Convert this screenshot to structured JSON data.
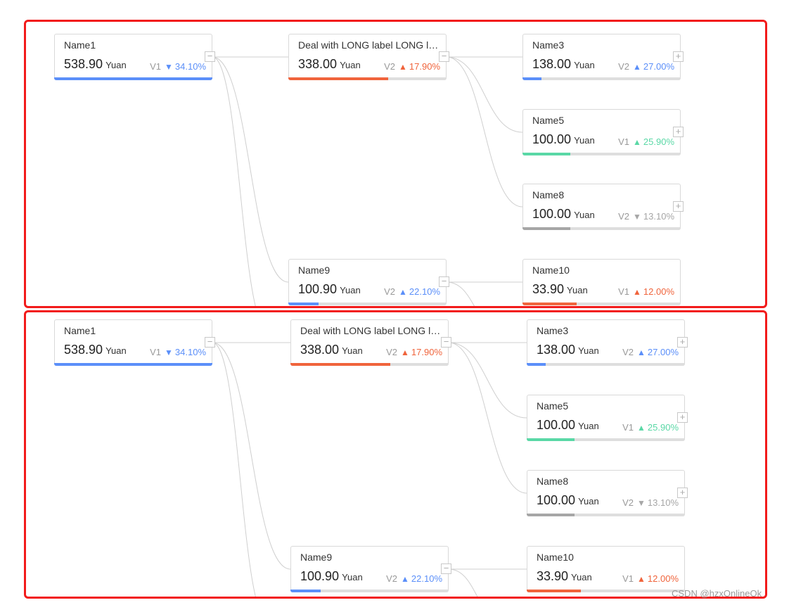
{
  "colors": {
    "blue": "#5b8ff9",
    "red": "#f0643c",
    "green": "#5ad8a6",
    "gray": "#a6a6a6",
    "frame": "#f21b1b"
  },
  "watermark": "CSDN @hzxOnlineOk",
  "panels": [
    {
      "id": "top",
      "nodes": [
        {
          "id": "n1",
          "name": "Name1",
          "value": "538.90",
          "unit": "Yuan",
          "tag": "V1",
          "dir": "down",
          "pct": "34.10%",
          "color": "blue",
          "progress": 1.0,
          "toggle": "−"
        },
        {
          "id": "n2",
          "name": "Deal with LONG label LONG la...",
          "value": "338.00",
          "unit": "Yuan",
          "tag": "V2",
          "dir": "up",
          "pct": "17.90%",
          "color": "red",
          "progress": 0.63,
          "toggle": "−"
        },
        {
          "id": "n3",
          "name": "Name3",
          "value": "138.00",
          "unit": "Yuan",
          "tag": "V2",
          "dir": "up",
          "pct": "27.00%",
          "color": "blue",
          "progress": 0.12,
          "toggle": "+"
        },
        {
          "id": "n5",
          "name": "Name5",
          "value": "100.00",
          "unit": "Yuan",
          "tag": "V1",
          "dir": "up",
          "pct": "25.90%",
          "color": "green",
          "progress": 0.3,
          "toggle": "+"
        },
        {
          "id": "n8",
          "name": "Name8",
          "value": "100.00",
          "unit": "Yuan",
          "tag": "V2",
          "dir": "down",
          "pct": "13.10%",
          "color": "gray",
          "progress": 0.3,
          "toggle": "+"
        },
        {
          "id": "n9",
          "name": "Name9",
          "value": "100.90",
          "unit": "Yuan",
          "tag": "V2",
          "dir": "up",
          "pct": "22.10%",
          "color": "blue",
          "progress": 0.19,
          "toggle": "−"
        },
        {
          "id": "n10",
          "name": "Name10",
          "value": "33.90",
          "unit": "Yuan",
          "tag": "V1",
          "dir": "up",
          "pct": "12.00%",
          "color": "red",
          "progress": 0.34,
          "toggle": ""
        }
      ]
    },
    {
      "id": "bottom",
      "nodes": [
        {
          "id": "n1",
          "name": "Name1",
          "value": "538.90",
          "unit": "Yuan",
          "tag": "V1",
          "dir": "down",
          "pct": "34.10%",
          "color": "blue",
          "progress": 1.0,
          "toggle": "−"
        },
        {
          "id": "n2",
          "name": "Deal with LONG label LONG la...",
          "value": "338.00",
          "unit": "Yuan",
          "tag": "V2",
          "dir": "up",
          "pct": "17.90%",
          "color": "red",
          "progress": 0.63,
          "toggle": "−"
        },
        {
          "id": "n3",
          "name": "Name3",
          "value": "138.00",
          "unit": "Yuan",
          "tag": "V2",
          "dir": "up",
          "pct": "27.00%",
          "color": "blue",
          "progress": 0.12,
          "toggle": "+"
        },
        {
          "id": "n5",
          "name": "Name5",
          "value": "100.00",
          "unit": "Yuan",
          "tag": "V1",
          "dir": "up",
          "pct": "25.90%",
          "color": "green",
          "progress": 0.3,
          "toggle": "+"
        },
        {
          "id": "n8",
          "name": "Name8",
          "value": "100.00",
          "unit": "Yuan",
          "tag": "V2",
          "dir": "down",
          "pct": "13.10%",
          "color": "gray",
          "progress": 0.3,
          "toggle": "+"
        },
        {
          "id": "n9",
          "name": "Name9",
          "value": "100.90",
          "unit": "Yuan",
          "tag": "V2",
          "dir": "up",
          "pct": "22.10%",
          "color": "blue",
          "progress": 0.19,
          "toggle": "−"
        },
        {
          "id": "n10",
          "name": "Name10",
          "value": "33.90",
          "unit": "Yuan",
          "tag": "V1",
          "dir": "up",
          "pct": "12.00%",
          "color": "red",
          "progress": 0.34,
          "toggle": ""
        }
      ]
    }
  ]
}
